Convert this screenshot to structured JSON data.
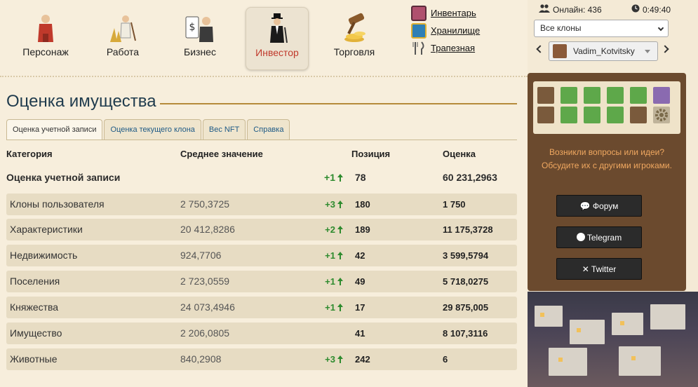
{
  "nav": {
    "items": [
      {
        "label": "Персонаж",
        "icon": "character-icon"
      },
      {
        "label": "Работа",
        "icon": "work-icon"
      },
      {
        "label": "Бизнес",
        "icon": "business-icon"
      },
      {
        "label": "Инвестор",
        "icon": "investor-icon",
        "active": true
      },
      {
        "label": "Торговля",
        "icon": "trade-icon"
      }
    ],
    "side_links": [
      {
        "label": "Инвентарь",
        "icon": "inventory-icon"
      },
      {
        "label": "Хранилище",
        "icon": "storage-icon"
      },
      {
        "label": "Трапезная",
        "icon": "refectory-icon"
      }
    ]
  },
  "page": {
    "title": "Оценка имущества",
    "tabs": [
      "Оценка учетной записи",
      "Оценка текущего клона",
      "Вес NFT",
      "Справка"
    ]
  },
  "table": {
    "headers": [
      "Категория",
      "Среднее значение",
      "Позиция",
      "Оценка"
    ],
    "total": {
      "category": "Оценка учетной записи",
      "change": "+1",
      "position": "78",
      "score": "60 231,2963"
    },
    "rows": [
      {
        "category": "Клоны пользователя",
        "average": "2 750,3725",
        "change": "+3",
        "position": "180",
        "score": "1 750"
      },
      {
        "category": "Характеристики",
        "average": "20 412,8286",
        "change": "+2",
        "position": "189",
        "score": "11 175,3728"
      },
      {
        "category": "Недвижимость",
        "average": "924,7706",
        "change": "+1",
        "position": "42",
        "score": "3 599,5794"
      },
      {
        "category": "Поселения",
        "average": "2 723,0559",
        "change": "+1",
        "position": "49",
        "score": "5 718,0275"
      },
      {
        "category": "Княжества",
        "average": "24 073,4946",
        "change": "+1",
        "position": "17",
        "score": "29 875,005"
      },
      {
        "category": "Имущество",
        "average": "2 206,0805",
        "change": "",
        "position": "41",
        "score": "8 107,3116"
      },
      {
        "category": "Животные",
        "average": "840,2908",
        "change": "+3",
        "position": "242",
        "score": "6"
      }
    ]
  },
  "sidebar": {
    "online_label": "Онлайн: 436",
    "time": "0:49:40",
    "clone_filter": "Все клоны",
    "clone_name": "Vadim_Kotvitsky",
    "help_text": "Возникли вопросы или идеи? Обсудите их с другими игроками.",
    "buttons": [
      "Форум",
      "Telegram",
      "Twitter"
    ]
  },
  "colors": {
    "accent": "#c0392b",
    "positive": "#2e8b2e",
    "title": "#1f3b4d",
    "panel": "#6b4a2e"
  }
}
